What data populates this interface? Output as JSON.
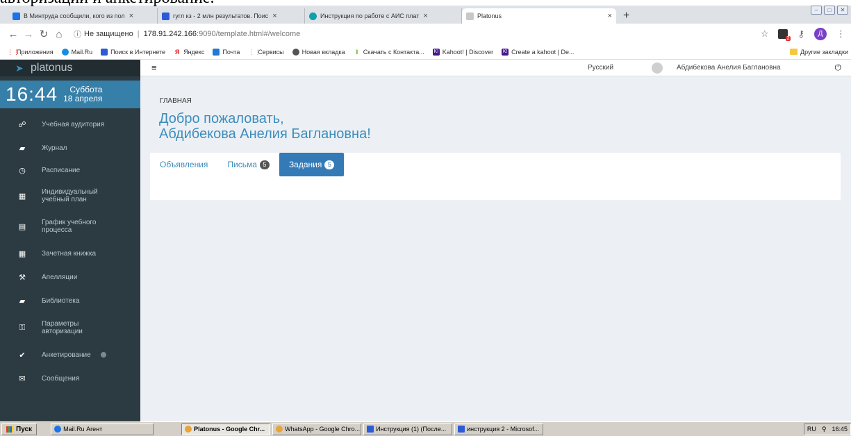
{
  "document_fragment": "авторизации и анкетирование.",
  "browser": {
    "tabs": [
      {
        "title": "В Минтруда сообщили, кого из пол",
        "color": "#1a73e8",
        "active": false
      },
      {
        "title": "гугл кз - 2 млн результатов. Поис",
        "color": "#2b5bd6",
        "active": false
      },
      {
        "title": "Инструкция по работе с АИС плат",
        "color": "#0fa0a8",
        "active": false
      },
      {
        "title": "Platonus",
        "color": "#c8c8c8",
        "active": true
      }
    ],
    "new_tab": "+",
    "url": {
      "security": "Не защищено",
      "host": "178.91.242.166",
      "path": ":9090/template.html#/welcome"
    },
    "profile_initial": "Д",
    "extension_badge": "2",
    "bookmarks": [
      {
        "label": "Приложения",
        "color": "#4285f4"
      },
      {
        "label": "Mail.Ru",
        "color": "#168de2"
      },
      {
        "label": "Поиск в Интернете",
        "color": "#2b5bd6"
      },
      {
        "label": "Яндекс",
        "color": "#e31e24"
      },
      {
        "label": "Почта",
        "color": "#1f7bd1"
      },
      {
        "label": "Сервисы",
        "color": "#4285f4"
      },
      {
        "label": "Новая вкладка",
        "color": "#555555"
      },
      {
        "label": "Скачать с Контакта...",
        "color": "#8bc34a"
      },
      {
        "label": "Kahoot! | Discover",
        "color": "#46178f"
      },
      {
        "label": "Create a kahoot | De...",
        "color": "#46178f"
      }
    ],
    "other_bookmarks": "Другие закладки"
  },
  "app": {
    "brand": "platonus",
    "clock": {
      "time": "16:44",
      "weekday": "Суббота",
      "date": "18 апреля"
    },
    "menu": [
      {
        "label": "Учебная аудитория",
        "icon": "users-icon",
        "glyph": "☍"
      },
      {
        "label": "Журнал",
        "icon": "book-icon",
        "glyph": "▰"
      },
      {
        "label": "Расписание",
        "icon": "clock-icon",
        "glyph": "◷"
      },
      {
        "label": "Индивидуальный\nучебный план",
        "icon": "grid-icon",
        "glyph": "▦"
      },
      {
        "label": "График учебного\nпроцесса",
        "icon": "calendar-icon",
        "glyph": "▤"
      },
      {
        "label": "Зачетная книжка",
        "icon": "table-icon",
        "glyph": "▦"
      },
      {
        "label": "Апелляции",
        "icon": "gavel-icon",
        "glyph": "⚒"
      },
      {
        "label": "Библиотека",
        "icon": "book-icon",
        "glyph": "▰"
      },
      {
        "label": "Параметры\nавторизации",
        "icon": "key-icon",
        "glyph": "⚿"
      },
      {
        "label": "Анкетирование",
        "icon": "check-circle-icon",
        "glyph": "✔"
      },
      {
        "label": "Сообщения",
        "icon": "comments-icon",
        "glyph": "✉"
      }
    ],
    "topbar": {
      "language": "Русский",
      "user": "Абдибекова Анелия Баглановна"
    },
    "breadcrumb": "ГЛАВНАЯ",
    "welcome_line1": "Добро пожаловать,",
    "welcome_line2": "Абдибекова Анелия Баглановна!",
    "tabs": [
      {
        "label": "Объявления",
        "badge": null,
        "active": false
      },
      {
        "label": "Письма",
        "badge": "5",
        "active": false
      },
      {
        "label": "Задания",
        "badge": "5",
        "active": true
      }
    ]
  },
  "taskbar": {
    "start": "Пуск",
    "items": [
      {
        "label": "Mail.Ru Агент",
        "color": "#1a73e8",
        "active": false
      },
      {
        "label": "Platonus - Google Chr...",
        "color": "#e8a33b",
        "active": true
      },
      {
        "label": "WhatsApp - Google Chro...",
        "color": "#e8a33b",
        "active": false
      },
      {
        "label": "Инструкция (1) (После...",
        "color": "#2b5bd6",
        "active": false
      },
      {
        "label": "инструкция 2 - Microsof...",
        "color": "#2b5bd6",
        "active": false
      }
    ],
    "lang": "RU",
    "time": "16:45"
  }
}
